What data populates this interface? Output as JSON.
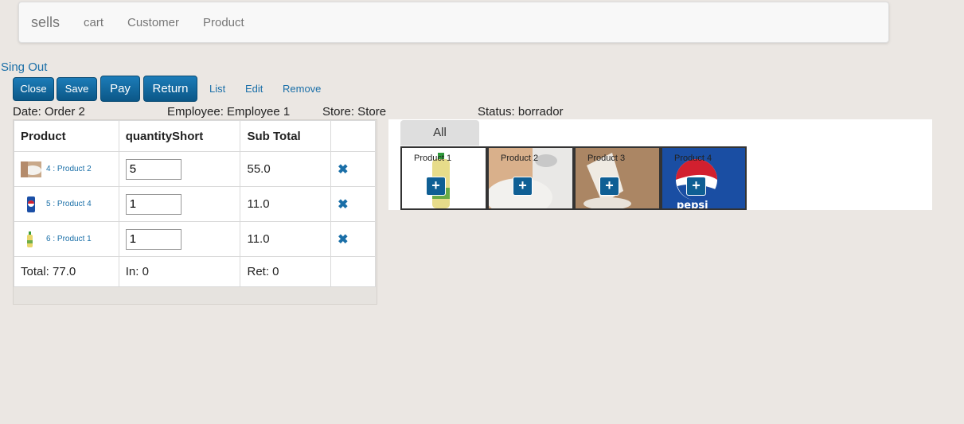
{
  "navbar": {
    "brand": "sells",
    "items": [
      "cart",
      "Customer",
      "Product"
    ]
  },
  "signout": "Sing Out",
  "toolbar": {
    "close": "Close",
    "save": "Save",
    "pay": "Pay",
    "return": "Return",
    "list": "List",
    "edit": "Edit",
    "remove": "Remove"
  },
  "info": {
    "date": "Date: Order 2",
    "employee": "Employee: Employee 1",
    "store": "Store: Store",
    "status": "Status: borrador"
  },
  "table": {
    "headers": [
      "Product",
      "quantityShort",
      "Sub Total",
      ""
    ],
    "rows": [
      {
        "product": "4 : Product 2",
        "qty": "5",
        "subtotal": "55.0",
        "thumb": "sugar-image"
      },
      {
        "product": "5 : Product 4",
        "qty": "1",
        "subtotal": "11.0",
        "thumb": "pepsi-can-image"
      },
      {
        "product": "6 : Product 1",
        "qty": "1",
        "subtotal": "11.0",
        "thumb": "oil-bottle-image"
      }
    ],
    "footer": {
      "total": "Total: 77.0",
      "in": "In: 0",
      "ret": "Ret: 0"
    }
  },
  "catalog": {
    "tab": "All",
    "products": [
      {
        "label": "Product 1",
        "image": "oil-bottle-image"
      },
      {
        "label": "Product 2",
        "image": "sugar-spoon-image"
      },
      {
        "label": "Product 3",
        "image": "sugar-bag-image"
      },
      {
        "label": "Product 4",
        "image": "pepsi-can-image"
      }
    ]
  },
  "colors": {
    "accent": "#0b5787",
    "link": "#1a6fa8",
    "background": "#ebe7e3"
  }
}
